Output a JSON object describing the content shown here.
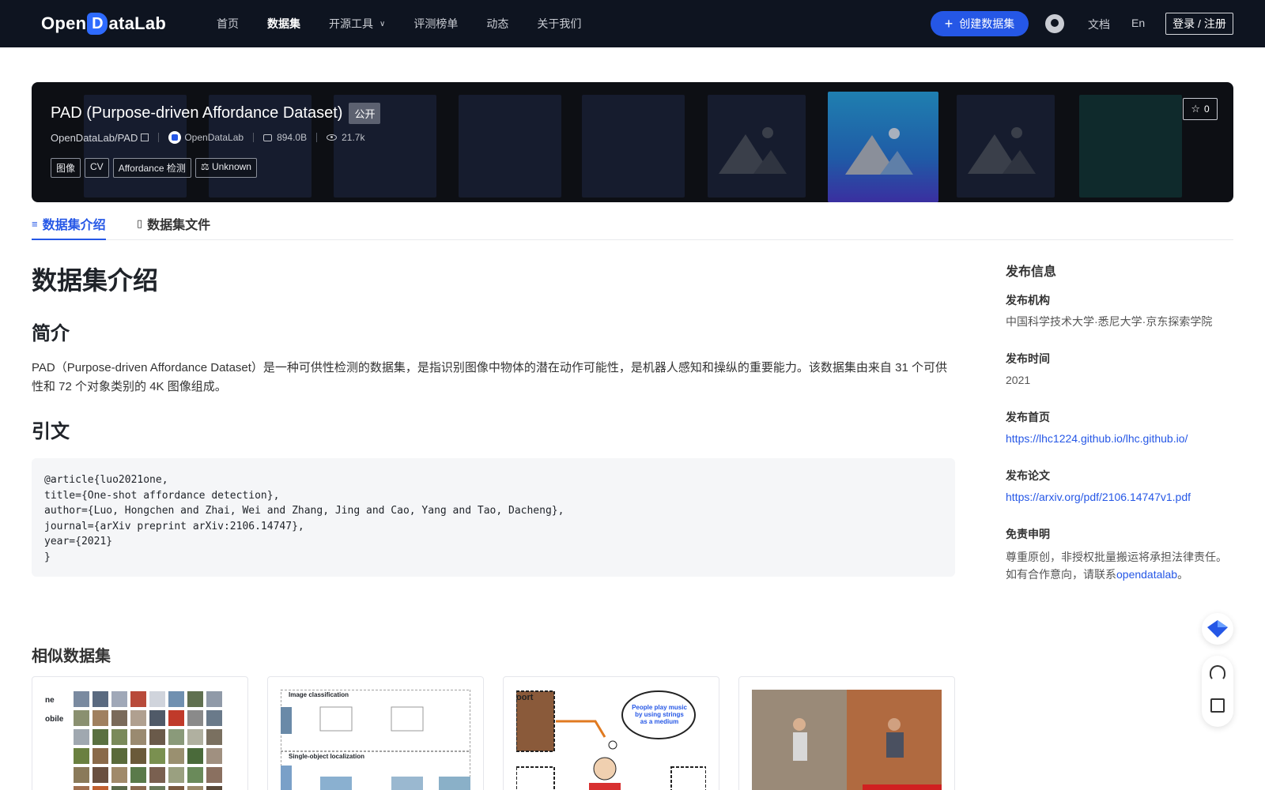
{
  "nav": {
    "logo": "OpenDataLab",
    "items": [
      "首页",
      "数据集",
      "开源工具",
      "评测榜单",
      "动态",
      "关于我们"
    ],
    "active": "数据集",
    "create_button": "创建数据集",
    "docs": "文档",
    "lang": "En",
    "login": "登录 / 注册"
  },
  "dataset": {
    "title": "PAD (Purpose-driven Affordance Dataset)",
    "visibility": "公开",
    "repo": "OpenDataLab/PAD",
    "org": "OpenDataLab",
    "size": "894.0B",
    "views": "21.7k",
    "tags": [
      "图像",
      "CV",
      "Affordance 检测",
      "Unknown"
    ],
    "stars": "0"
  },
  "tabs": [
    "数据集介绍",
    "数据集文件"
  ],
  "content": {
    "h1": "数据集介绍",
    "intro_title": "简介",
    "intro_text": "PAD（Purpose-driven Affordance Dataset）是一种可供性检测的数据集，是指识别图像中物体的潜在动作可能性，是机器人感知和操纵的重要能力。该数据集由来自 31 个可供性和 72 个对象类别的 4K 图像组成。",
    "citation_title": "引文",
    "citation": "@article{luo2021one,\ntitle={One-shot affordance detection},\nauthor={Luo, Hongchen and Zhai, Wei and Zhang, Jing and Cao, Yang and Tao, Dacheng},\njournal={arXiv preprint arXiv:2106.14747},\nyear={2021}\n}"
  },
  "sidebar": {
    "title": "发布信息",
    "org_label": "发布机构",
    "org_value": "中国科学技术大学·悉尼大学·京东探索学院",
    "time_label": "发布时间",
    "time_value": "2021",
    "home_label": "发布首页",
    "home_value": "https://lhc1224.github.io/lhc.github.io/",
    "paper_label": "发布论文",
    "paper_value": "https://arxiv.org/pdf/2106.14747v1.pdf",
    "disclaimer_label": "免责申明",
    "disclaimer_line1": "尊重原创，非授权批量搬运将承担法律责任。",
    "disclaimer_line2_pre": "如有合作意向，请联系",
    "disclaimer_link": "opendatalab",
    "disclaimer_line2_post": "。"
  },
  "similar": {
    "title": "相似数据集",
    "card_texts": [
      "ne",
      "obile",
      "Image classification",
      "Single-object localization",
      "oort",
      "People play music by using strings as a medium"
    ]
  },
  "icons": [
    "plus-icon",
    "github-icon",
    "copy-icon",
    "disk-icon",
    "eye-icon",
    "scale-icon",
    "star-icon",
    "database-icon",
    "file-icon",
    "headset-icon",
    "edit-icon"
  ],
  "colors": {
    "nav_bg": "#0e1420",
    "accent": "#2557e6",
    "banner_bg": "#0d0f14"
  }
}
